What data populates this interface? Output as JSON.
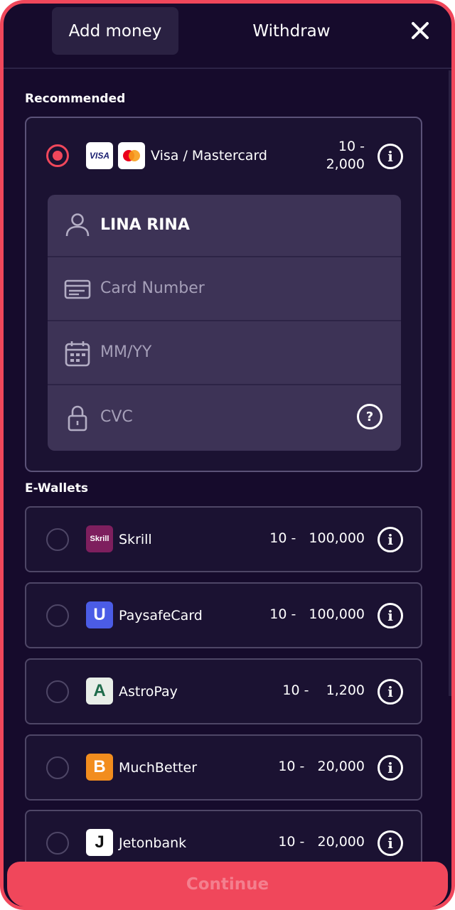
{
  "tabs": {
    "add_money": "Add money",
    "withdraw": "Withdraw"
  },
  "sections": {
    "recommended": "Recommended",
    "ewallets": "E-Wallets"
  },
  "card_method": {
    "visa_logo_text": "VISA",
    "name": "Visa / Mastercard",
    "range_min": "10 -",
    "range_max": "2,000",
    "selected": true
  },
  "card_form": {
    "holder_name": "LINA RINA",
    "card_number_placeholder": "Card Number",
    "expiry_placeholder": "MM/YY",
    "cvc_placeholder": "CVC",
    "help_symbol": "?"
  },
  "wallets": [
    {
      "name": "Skrill",
      "logo_text": "Skrill",
      "range": "10 -   100,000",
      "logo_color": "#7e1f5e"
    },
    {
      "name": "PaysafeCard",
      "logo_text": "U",
      "range": "10 -   100,000",
      "logo_color": "#4b5ce6"
    },
    {
      "name": "AstroPay",
      "logo_text": "A",
      "range": "10 -    1,200",
      "logo_color": "#e8eee8"
    },
    {
      "name": "MuchBetter",
      "logo_text": "B",
      "range": "10 -   20,000",
      "logo_color": "#f28d1e"
    },
    {
      "name": "Jetonbank",
      "logo_text": "J",
      "range": "10 -   20,000",
      "logo_color": "#ffffff"
    }
  ],
  "info_symbol": "i",
  "continue_label": "Continue",
  "colors": {
    "accent": "#f0475b",
    "background": "#160b2c",
    "card": "#1b1232",
    "form": "#3d3356"
  }
}
